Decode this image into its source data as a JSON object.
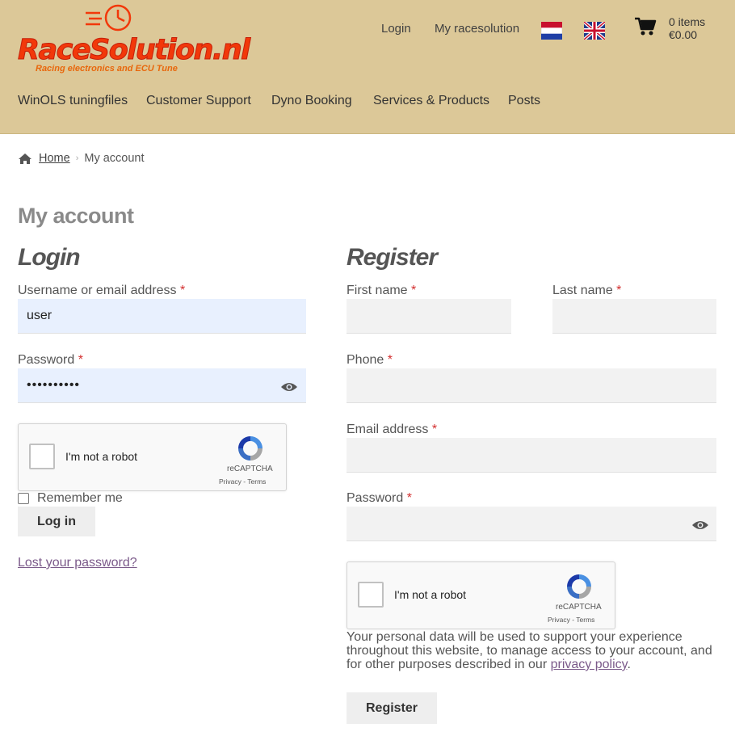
{
  "header": {
    "logo_text": "RaceSolution.nl",
    "logo_tagline": "Racing electronics and ECU Tune",
    "links": {
      "login": "Login",
      "my_account": "My racesolution"
    },
    "cart": {
      "items": "0 items",
      "total": "€0.00"
    },
    "flags": [
      "netherlands-flag",
      "uk-flag"
    ]
  },
  "nav": {
    "items": [
      "WinOLS tuningfiles",
      "Customer Support",
      "Dyno Booking",
      "Services & Products",
      "Posts"
    ]
  },
  "breadcrumb": {
    "home": "Home",
    "current": "My account"
  },
  "page_title": "My account",
  "login": {
    "title": "Login",
    "username_label": "Username or email address",
    "username_value": "user",
    "password_label": "Password",
    "password_value": "••••••••••",
    "remember_label": "Remember me",
    "button": "Log in",
    "lost_password": "Lost your password?"
  },
  "register": {
    "title": "Register",
    "first_name_label": "First name",
    "last_name_label": "Last name",
    "phone_label": "Phone",
    "email_label": "Email address",
    "password_label": "Password",
    "privacy_text": "Your personal data will be used to support your experience throughout this website, to manage access to your account, and for other purposes described in our ",
    "privacy_link": "privacy policy",
    "privacy_end": ".",
    "button": "Register"
  },
  "recaptcha": {
    "label": "I'm not a robot",
    "brand": "reCAPTCHA",
    "terms": "Privacy - Terms"
  },
  "required_marker": "*",
  "colors": {
    "header_bg": "#dcc898",
    "logo_red": "#f2380a",
    "link_purple": "#7b5a8a",
    "autofill_blue": "#e8f0fe"
  }
}
